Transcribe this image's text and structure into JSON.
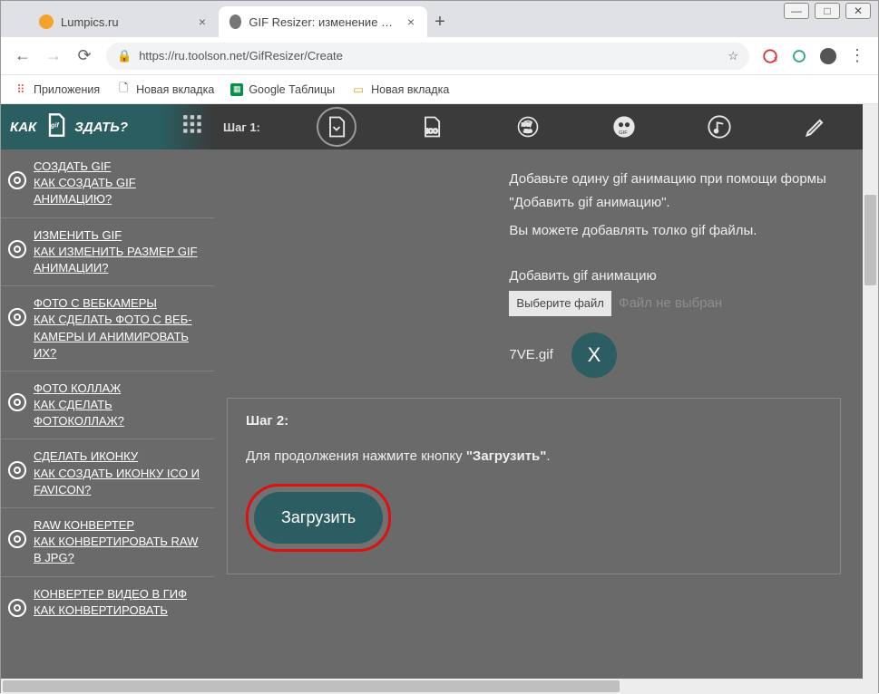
{
  "window": {
    "min": "—",
    "max": "□",
    "close": "✕"
  },
  "tabs": [
    {
      "title": "Lumpics.ru"
    },
    {
      "title": "GIF Resizer: изменение размера"
    }
  ],
  "addr": {
    "url": "https://ru.toolson.net/GifResizer/Create",
    "star": "☆"
  },
  "bookmarks": {
    "apps": "Приложения",
    "b1": "Новая вкладка",
    "b2": "Google Таблицы",
    "b3": "Новая вкладка"
  },
  "sidebar": {
    "header_left": "КАК",
    "header_right": "ЗДАТЬ?",
    "items": [
      {
        "t1": "СОЗДАТЬ GIF",
        "t2": "КАК СОЗДАТЬ GIF АНИМАЦИЮ?"
      },
      {
        "t1": "ИЗМЕНИТЬ GIF",
        "t2": "КАК ИЗМЕНИТЬ РАЗМЕР GIF АНИМАЦИИ?"
      },
      {
        "t1": "ФОТО С ВЕБКАМЕРЫ",
        "t2": "КАК СДЕЛАТЬ ФОТО С ВЕБ-КАМЕРЫ И АНИМИРОВАТЬ ИХ?"
      },
      {
        "t1": "ФОТО КОЛЛАЖ",
        "t2": "КАК СДЕЛАТЬ ФОТОКОЛЛАЖ?"
      },
      {
        "t1": "СДЕЛАТЬ ИКОНКУ",
        "t2": "КАК СОЗДАТЬ ИКОНКУ ICO И FAVICON?"
      },
      {
        "t1": "RAW КОНВЕРТЕР",
        "t2": "КАК КОНВЕРТИРОВАТЬ RAW В JPG?"
      },
      {
        "t1": "КОНВЕРТЕР ВИДЕО В ГИФ",
        "t2": "КАК КОНВЕРТИРОВАТЬ"
      }
    ]
  },
  "main": {
    "step1": "Шаг 1:",
    "instr1": "Добавьте одину gif анимацию при помощи формы \"Добавить gif анимацию\".",
    "instr2": "Вы можете добавлять толко gif файлы.",
    "addlabel": "Добавить gif анимацию",
    "choose": "Выберите файл",
    "nofile": "Файл не выбран",
    "filename": "7VE.gif",
    "x": "X",
    "step2_title": "Шаг 2:",
    "step2_desc_a": "Для продолжения нажмите кнопку ",
    "step2_desc_b": "\"Загрузить\"",
    "step2_desc_c": ".",
    "upload": "Загрузить"
  }
}
